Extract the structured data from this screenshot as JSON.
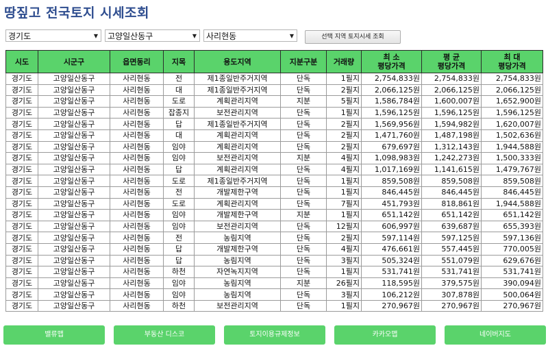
{
  "title": "땅짚고 전국토지 시세조회",
  "filters": {
    "province": "경기도",
    "district": "고양일산동구",
    "dong": "사리현동",
    "search_button": "선택 지역 토지시세 조회"
  },
  "table": {
    "headers": [
      "시도",
      "시군구",
      "읍면동리",
      "지목",
      "용도지역",
      "지분구분",
      "거래량",
      "최    소\n평당가격",
      "평    균\n평당가격",
      "최    대\n평당가격"
    ],
    "rows": [
      [
        "경기도",
        "고양일산동구",
        "사리현동",
        "전",
        "제1종일반주거지역",
        "단독",
        "1필지",
        "2,754,833원",
        "2,754,833원",
        "2,754,833원"
      ],
      [
        "경기도",
        "고양일산동구",
        "사리현동",
        "대",
        "제1종일반주거지역",
        "단독",
        "2필지",
        "2,066,125원",
        "2,066,125원",
        "2,066,125원"
      ],
      [
        "경기도",
        "고양일산동구",
        "사리현동",
        "도로",
        "계획관리지역",
        "지분",
        "5필지",
        "1,586,784원",
        "1,600,007원",
        "1,652,900원"
      ],
      [
        "경기도",
        "고양일산동구",
        "사리현동",
        "잡종지",
        "보전관리지역",
        "단독",
        "1필지",
        "1,596,125원",
        "1,596,125원",
        "1,596,125원"
      ],
      [
        "경기도",
        "고양일산동구",
        "사리현동",
        "답",
        "제1종일반주거지역",
        "단독",
        "2필지",
        "1,569,956원",
        "1,594,982원",
        "1,620,007원"
      ],
      [
        "경기도",
        "고양일산동구",
        "사리현동",
        "대",
        "계획관리지역",
        "단독",
        "2필지",
        "1,471,760원",
        "1,487,198원",
        "1,502,636원"
      ],
      [
        "경기도",
        "고양일산동구",
        "사리현동",
        "임야",
        "계획관리지역",
        "단독",
        "2필지",
        "679,697원",
        "1,312,143원",
        "1,944,588원"
      ],
      [
        "경기도",
        "고양일산동구",
        "사리현동",
        "임야",
        "보전관리지역",
        "지분",
        "4필지",
        "1,098,983원",
        "1,242,273원",
        "1,500,333원"
      ],
      [
        "경기도",
        "고양일산동구",
        "사리현동",
        "답",
        "계획관리지역",
        "단독",
        "4필지",
        "1,017,169원",
        "1,141,615원",
        "1,479,767원"
      ],
      [
        "경기도",
        "고양일산동구",
        "사리현동",
        "도로",
        "제1종일반주거지역",
        "단독",
        "1필지",
        "859,508원",
        "859,508원",
        "859,508원"
      ],
      [
        "경기도",
        "고양일산동구",
        "사리현동",
        "전",
        "개발제한구역",
        "단독",
        "1필지",
        "846,445원",
        "846,445원",
        "846,445원"
      ],
      [
        "경기도",
        "고양일산동구",
        "사리현동",
        "도로",
        "계획관리지역",
        "단독",
        "7필지",
        "451,793원",
        "818,861원",
        "1,944,588원"
      ],
      [
        "경기도",
        "고양일산동구",
        "사리현동",
        "임야",
        "개발제한구역",
        "지분",
        "1필지",
        "651,142원",
        "651,142원",
        "651,142원"
      ],
      [
        "경기도",
        "고양일산동구",
        "사리현동",
        "임야",
        "보전관리지역",
        "단독",
        "12필지",
        "606,997원",
        "639,687원",
        "655,393원"
      ],
      [
        "경기도",
        "고양일산동구",
        "사리현동",
        "전",
        "농림지역",
        "단독",
        "2필지",
        "597,114원",
        "597,125원",
        "597,136원"
      ],
      [
        "경기도",
        "고양일산동구",
        "사리현동",
        "답",
        "개발제한구역",
        "단독",
        "4필지",
        "476,661원",
        "557,445원",
        "770,005원"
      ],
      [
        "경기도",
        "고양일산동구",
        "사리현동",
        "답",
        "농림지역",
        "단독",
        "3필지",
        "505,324원",
        "551,079원",
        "629,676원"
      ],
      [
        "경기도",
        "고양일산동구",
        "사리현동",
        "하천",
        "자연녹지지역",
        "단독",
        "1필지",
        "531,741원",
        "531,741원",
        "531,741원"
      ],
      [
        "경기도",
        "고양일산동구",
        "사리현동",
        "임야",
        "농림지역",
        "지분",
        "26필지",
        "118,595원",
        "379,575원",
        "390,094원"
      ],
      [
        "경기도",
        "고양일산동구",
        "사리현동",
        "임야",
        "농림지역",
        "단독",
        "3필지",
        "106,212원",
        "307,878원",
        "500,064원"
      ],
      [
        "경기도",
        "고양일산동구",
        "사리현동",
        "하천",
        "보전관리지역",
        "단독",
        "1필지",
        "270,967원",
        "270,967원",
        "270,967원"
      ]
    ]
  },
  "bottom_buttons": [
    "밸류맵",
    "부동산 디스코",
    "토지이용규제정보",
    "카카오맵",
    "네이버지도"
  ],
  "colors": {
    "accent": "#5ad36b",
    "title": "#2e4d8f"
  }
}
